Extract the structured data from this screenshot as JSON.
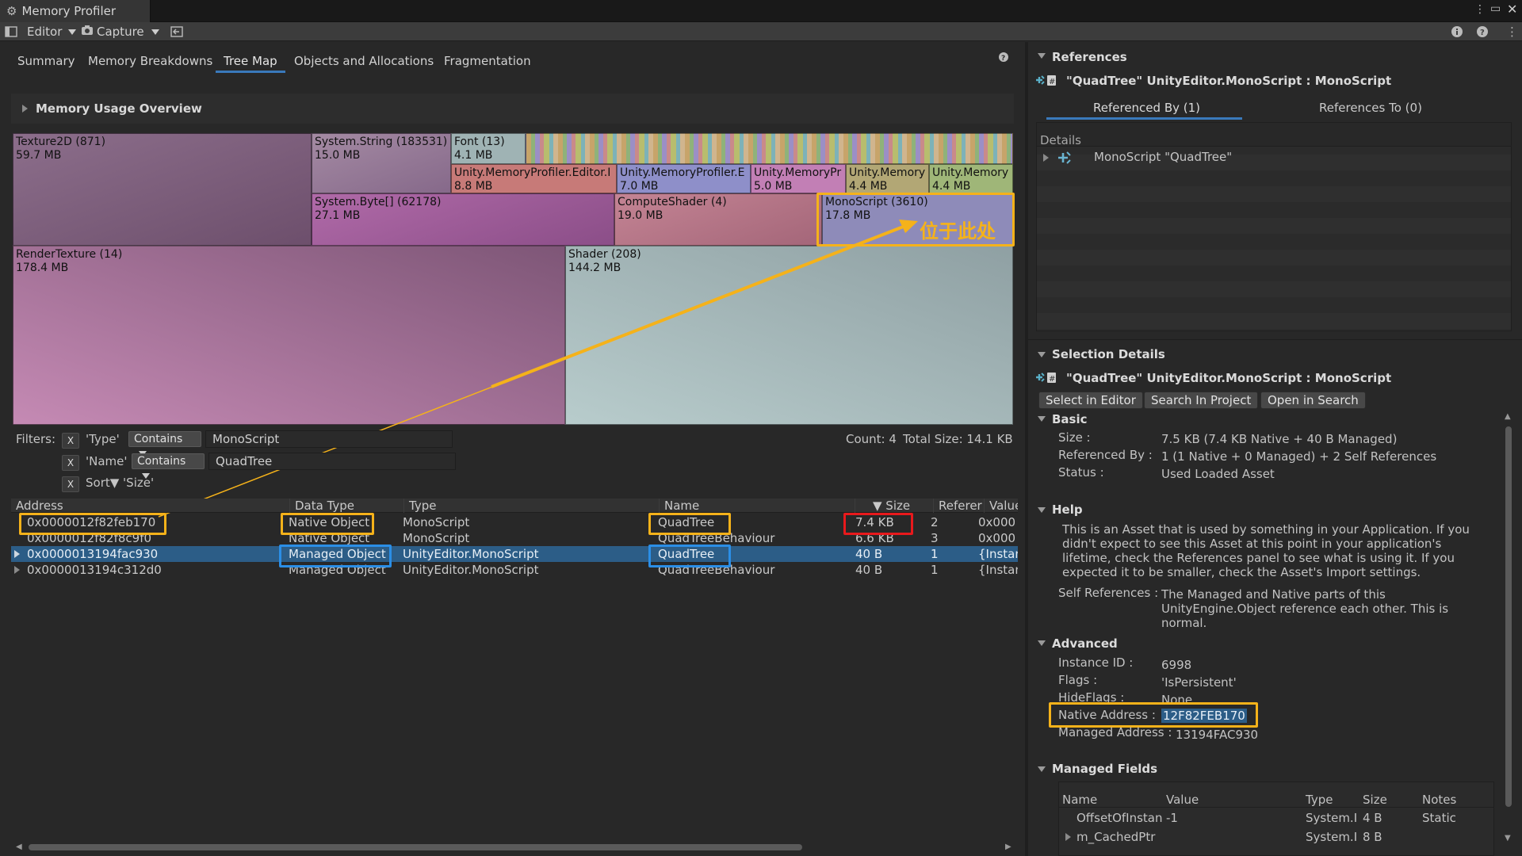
{
  "window": {
    "title": "Memory Profiler"
  },
  "toolbar": {
    "editor_label": "Editor",
    "capture_label": "Capture"
  },
  "nav_tabs": [
    "Summary",
    "Memory Breakdowns",
    "Tree Map",
    "Objects and Allocations",
    "Fragmentation"
  ],
  "active_tab": "Tree Map",
  "overview": {
    "label": "Memory Usage Overview"
  },
  "treemap": {
    "cells": [
      {
        "name": "Texture2D (871)",
        "size": "59.7 MB"
      },
      {
        "name": "System.String (183531)",
        "size": "15.0 MB"
      },
      {
        "name": "Font (13)",
        "size": "4.1 MB"
      },
      {
        "name": "Unity.MemoryProfiler.Editor.I",
        "size": "8.8 MB"
      },
      {
        "name": "Unity.MemoryProfiler.E",
        "size": "7.0 MB"
      },
      {
        "name": "Unity.MemoryPr",
        "size": "5.0 MB"
      },
      {
        "name": "Unity.Memory",
        "size": "4.4 MB"
      },
      {
        "name": "Unity.Memory",
        "size": "4.4 MB"
      },
      {
        "name": "System.Byte[] (62178)",
        "size": "27.1 MB"
      },
      {
        "name": "ComputeShader (4)",
        "size": "19.0 MB"
      },
      {
        "name": "MonoScript (3610)",
        "size": "17.8 MB"
      },
      {
        "name": "RenderTexture (14)",
        "size": "178.4 MB"
      },
      {
        "name": "Shader (208)",
        "size": "144.2 MB"
      }
    ],
    "annotation": "位于此处"
  },
  "filters": {
    "label": "Filters:",
    "rows": [
      {
        "x": "X",
        "field": "'Type'",
        "op": "Contains",
        "value": "MonoScript"
      },
      {
        "x": "X",
        "field": "'Name'",
        "op": "Contains",
        "value": "QuadTree"
      },
      {
        "x": "X",
        "field": "Sort▼ 'Size'"
      }
    ],
    "count": "Count: 4",
    "total": "Total Size: 14.1 KB"
  },
  "table": {
    "columns": [
      "Address",
      "Data Type",
      "Type",
      "Name",
      "▼ Size",
      "Referer",
      "Value"
    ],
    "rows": [
      {
        "address": "0x0000012f82feb170",
        "data_type": "Native Object",
        "type": "MonoScript",
        "name": "QuadTree",
        "size": "7.4 KB",
        "refs": "2",
        "value": "0x000"
      },
      {
        "address": "0x0000012f82f8c9f0",
        "data_type": "Native Object",
        "type": "MonoScript",
        "name": "QuadTreeBehaviour",
        "size": "6.6 KB",
        "refs": "3",
        "value": "0x000"
      },
      {
        "address": "0x0000013194fac930",
        "data_type": "Managed Object",
        "type": "UnityEditor.MonoScript",
        "name": "QuadTree",
        "size": "40 B",
        "refs": "1",
        "value": "{Instan"
      },
      {
        "address": "0x0000013194c312d0",
        "data_type": "Managed Object",
        "type": "UnityEditor.MonoScript",
        "name": "QuadTreeBehaviour",
        "size": "40 B",
        "refs": "1",
        "value": "{Instan"
      }
    ]
  },
  "references": {
    "header": "References",
    "object_title": "\"QuadTree\" UnityEditor.MonoScript : MonoScript",
    "tab_by": "Referenced By (1)",
    "tab_to": "References To (0)",
    "details_label": "Details",
    "item": "MonoScript \"QuadTree\""
  },
  "selection": {
    "header": "Selection Details",
    "object_title": "\"QuadTree\" UnityEditor.MonoScript : MonoScript",
    "buttons": [
      "Select in Editor",
      "Search In Project",
      "Open in Search"
    ],
    "basic": {
      "header": "Basic",
      "size_label": "Size :",
      "size_value": "7.5 KB (7.4 KB Native + 40 B Managed)",
      "refby_label": "Referenced By :",
      "refby_value": "1 (1 Native + 0 Managed) + 2 Self References",
      "status_label": "Status :",
      "status_value": "Used Loaded Asset"
    },
    "help": {
      "header": "Help",
      "text": "This is an Asset that is used by something in your Application. If you didn't expect to see this Asset at this point in your application's lifetime, check the References panel to see what is using it. If you expected it to be smaller, check the Asset's Import settings.",
      "selfref_label": "Self References :",
      "selfref_value": "The Managed and Native parts of this UnityEngine.Object reference each other. This is normal."
    },
    "advanced": {
      "header": "Advanced",
      "instance_label": "Instance ID :",
      "instance_value": "6998",
      "flags_label": "Flags :",
      "flags_value": "'IsPersistent'",
      "hideflags_label": "HideFlags :",
      "hideflags_value": "None",
      "native_label": "Native Address :",
      "native_value": "12F82FEB170",
      "managed_label": "Managed Address :",
      "managed_value": "13194FAC930"
    },
    "managed_fields": {
      "header": "Managed Fields",
      "columns": [
        "Name",
        "Value",
        "Type",
        "Size",
        "Notes"
      ],
      "rows": [
        {
          "name": "OffsetOfInstan",
          "value": "-1",
          "type": "System.I",
          "size": "4 B",
          "notes": "Static"
        },
        {
          "name": "m_CachedPtr",
          "value": "",
          "type": "System.I",
          "size": "8 B",
          "notes": ""
        }
      ]
    }
  },
  "colors": {
    "highlight_yellow": "#f5b21a",
    "highlight_blue": "#2b8ee6",
    "highlight_red": "#e8191c",
    "selected_row": "#2c5d87",
    "active_tab_underline": "#3a79bb"
  }
}
